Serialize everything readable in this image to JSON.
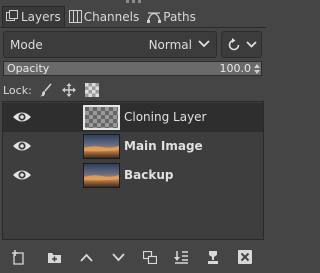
{
  "tabs": [
    {
      "label": "Layers",
      "icon": "layers-icon",
      "active": true
    },
    {
      "label": "Channels",
      "icon": "channels-icon",
      "active": false
    },
    {
      "label": "Paths",
      "icon": "paths-icon",
      "active": false
    }
  ],
  "mode": {
    "label": "Mode",
    "value": "Normal"
  },
  "opacity": {
    "label": "Opacity",
    "value": "100.0",
    "fraction": 1.0
  },
  "lock": {
    "label": "Lock:",
    "icons": [
      "paintbrush-icon",
      "move-icon",
      "alpha-checker-icon"
    ]
  },
  "layers": [
    {
      "name": "Cloning Layer",
      "bold": false,
      "selected": true,
      "thumbnail": "transparent-checker",
      "visible": true
    },
    {
      "name": "Main Image",
      "bold": true,
      "selected": false,
      "thumbnail": "sunset-sky",
      "visible": true
    },
    {
      "name": "Backup",
      "bold": true,
      "selected": false,
      "thumbnail": "sunset-sky",
      "visible": true
    }
  ],
  "toolbar": [
    "new-layer-icon",
    "new-group-icon",
    "raise-layer-icon",
    "lower-layer-icon",
    "duplicate-layer-icon",
    "merge-down-icon",
    "anchor-icon",
    "delete-layer-icon"
  ]
}
